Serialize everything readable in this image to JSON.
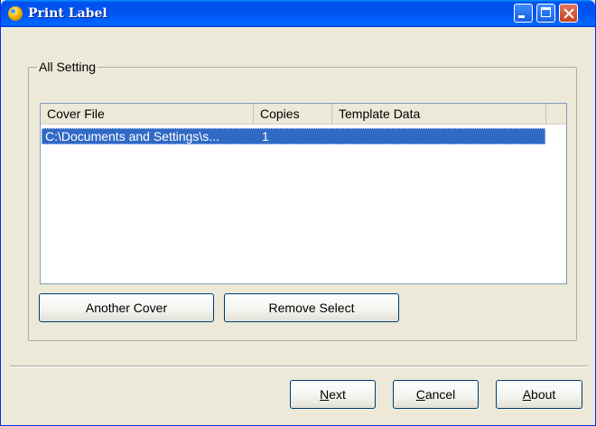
{
  "window": {
    "title": "Print Label"
  },
  "group": {
    "label": "All Setting"
  },
  "list": {
    "columns": [
      "Cover File",
      "Copies",
      "Template Data"
    ],
    "rows": [
      {
        "cover_file": "C:\\Documents and Settings\\s...",
        "copies": "1",
        "template_data": "",
        "selected": true
      }
    ]
  },
  "buttons": {
    "another_cover": "Another Cover",
    "remove_select": "Remove Select",
    "next": {
      "mnemonic": "N",
      "rest": "ext"
    },
    "cancel": {
      "mnemonic": "C",
      "rest": "ancel"
    },
    "about": {
      "mnemonic": "A",
      "rest": "bout"
    }
  },
  "colors": {
    "selection": "#316ac5",
    "titlebar": "#0053ee",
    "background": "#ece9d8"
  }
}
